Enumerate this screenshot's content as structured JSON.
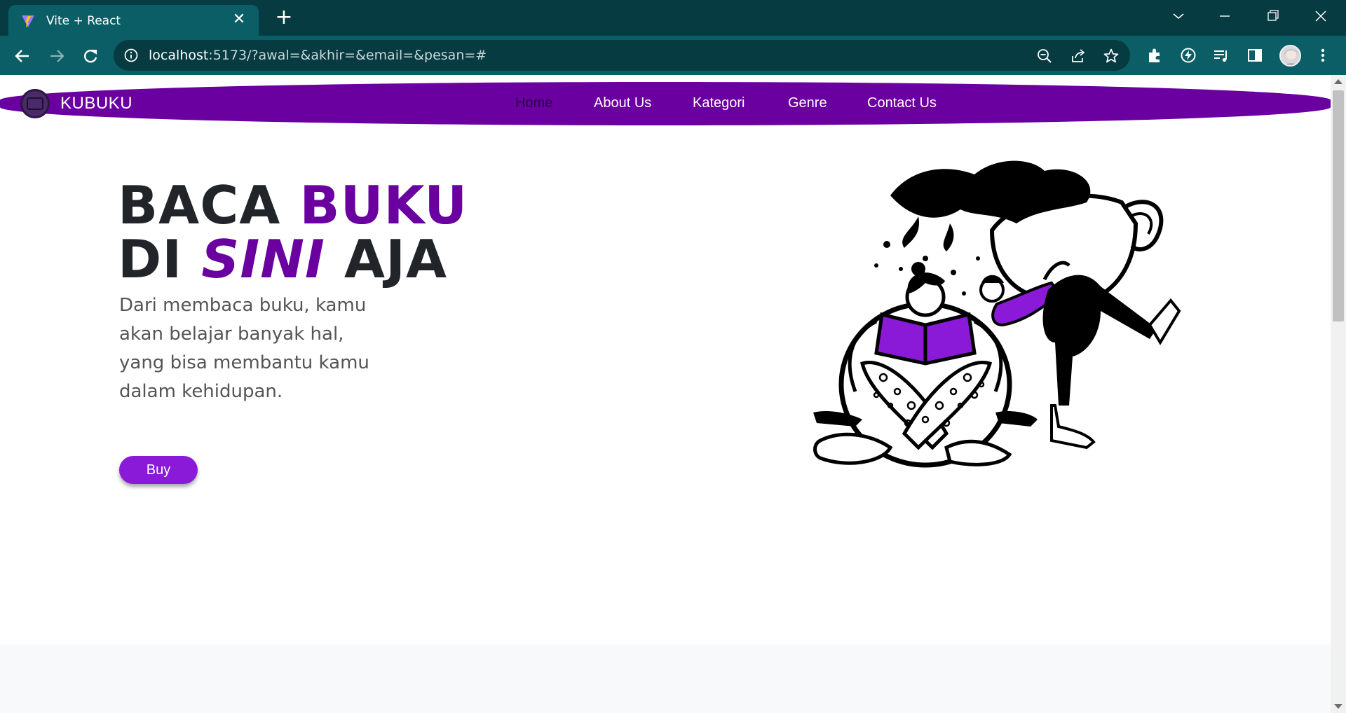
{
  "browser": {
    "tab_title": "Vite + React",
    "url_host": "localhost",
    "url_rest": ":5173/?awal=&akhir=&email=&pesan=#"
  },
  "navbar": {
    "brand": "KUBUKU",
    "links": [
      "Home",
      "About Us",
      "Kategori",
      "Genre",
      "Contact Us"
    ],
    "active_index": 0
  },
  "hero": {
    "title_line1_plain": "BACA",
    "title_line1_accent": "BUKU",
    "title_line2_plain": "DI",
    "title_line2_accent": "SINI",
    "title_line2_end": "AJA",
    "description": "Dari membaca buku, kamu akan belajar banyak hal, yang bisa membantu kamu dalam kehidupan.",
    "button_label": "Buy"
  },
  "colors": {
    "brand_purple": "#6a00a0",
    "button_purple": "#8a1ad8",
    "chrome_teal": "#0c5e66",
    "chrome_dark": "#073b42"
  }
}
